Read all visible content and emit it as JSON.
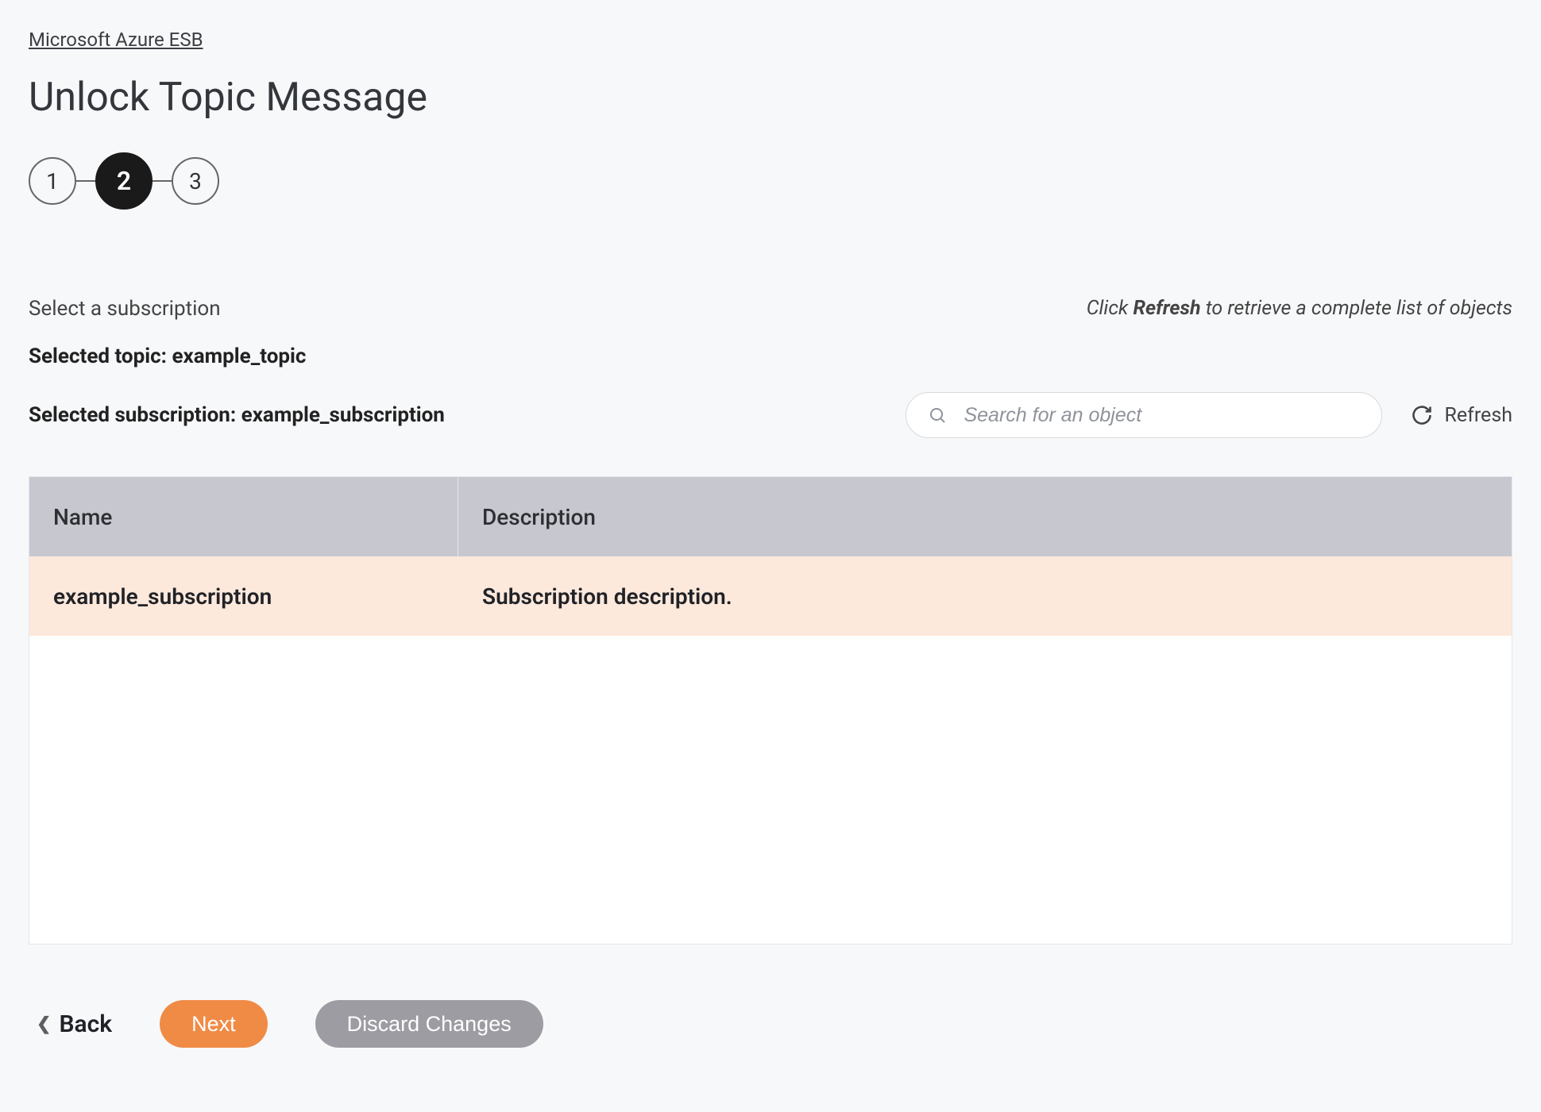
{
  "breadcrumb": "Microsoft Azure ESB",
  "page_title": "Unlock Topic Message",
  "stepper": {
    "steps": [
      "1",
      "2",
      "3"
    ],
    "active_index": 1
  },
  "select_sub_label": "Select a subscription",
  "refresh_hint_prefix": "Click ",
  "refresh_hint_bold": "Refresh",
  "refresh_hint_suffix": " to retrieve a complete list of objects",
  "selected_topic_label": "Selected topic: ",
  "selected_topic_value": "example_topic",
  "selected_sub_label": "Selected subscription: ",
  "selected_sub_value": "example_subscription",
  "search": {
    "placeholder": "Search for an object"
  },
  "refresh_button": "Refresh",
  "table": {
    "headers": {
      "name": "Name",
      "description": "Description"
    },
    "rows": [
      {
        "name": "example_subscription",
        "description": "Subscription description."
      }
    ]
  },
  "buttons": {
    "back": "Back",
    "next": "Next",
    "discard": "Discard Changes"
  }
}
